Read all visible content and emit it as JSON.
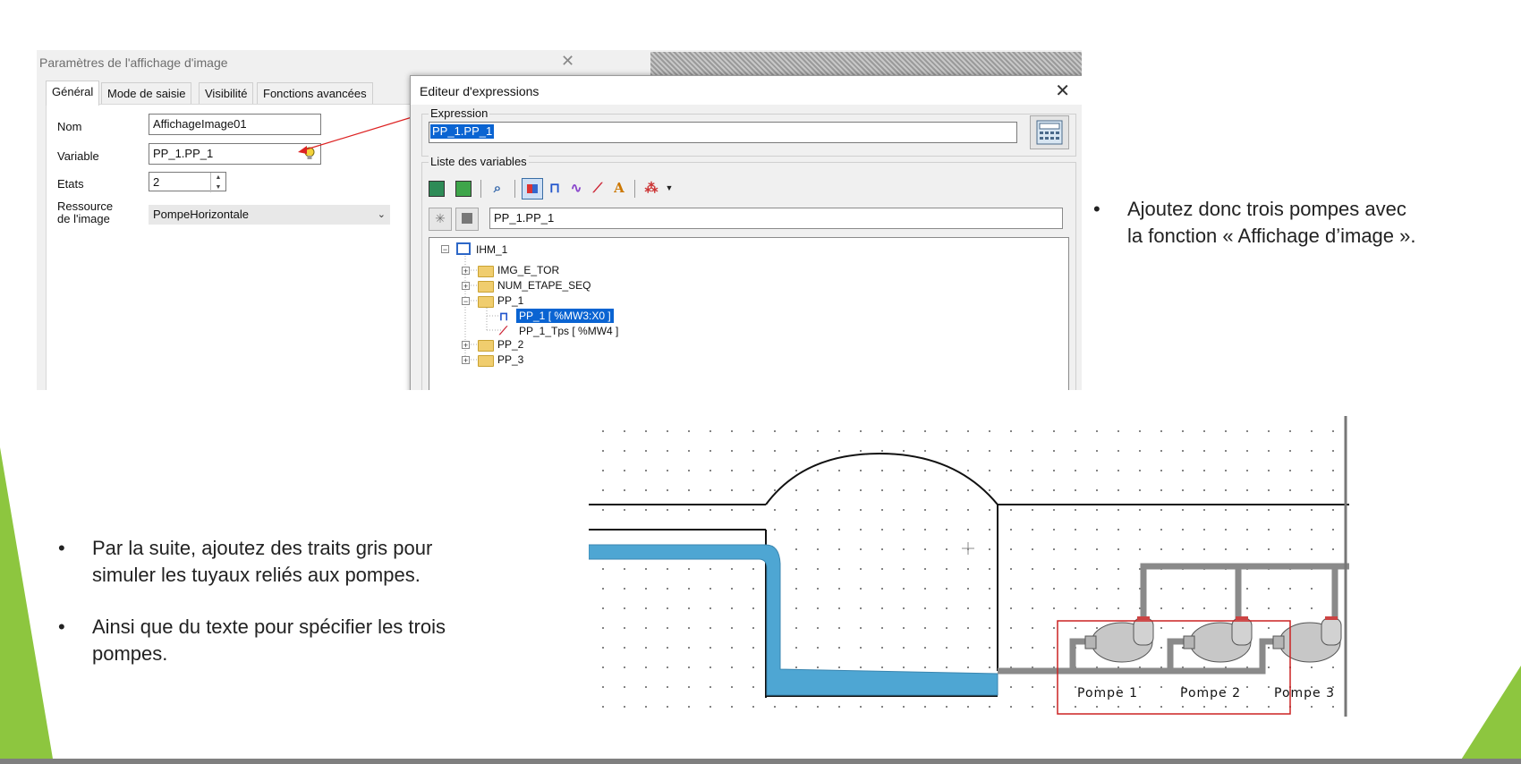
{
  "params_dialog": {
    "title": "Paramètres de l'affichage d'image",
    "close": "✕",
    "tabs": [
      "Général",
      "Mode de saisie",
      "Visibilité",
      "Fonctions avancées"
    ],
    "fields": {
      "nom_label": "Nom",
      "nom_value": "AffichageImage01",
      "variable_label": "Variable",
      "variable_value": "PP_1.PP_1",
      "etats_label": "Etats",
      "etats_value": "2",
      "ressource_label_1": "Ressource",
      "ressource_label_2": "de l'image",
      "ressource_value": "PompeHorizontale"
    }
  },
  "expr_editor": {
    "title": "Editeur d'expressions",
    "close": "✕",
    "expression_label": "Expression",
    "expression_value": "PP_1.PP_1",
    "variables_label": "Liste des variables",
    "filter_value": "PP_1.PP_1",
    "tree": {
      "root": "IHM_1",
      "items": [
        "IMG_E_TOR",
        "NUM_ETAPE_SEQ",
        "PP_1",
        "PP_2",
        "PP_3"
      ],
      "children": [
        "PP_1 [ %MW3:X0 ]",
        "PP_1_Tps [ %MW4 ]"
      ]
    }
  },
  "slide": {
    "bullet_right_1": "Ajoutez donc trois pompes avec",
    "bullet_right_2": "la fonction « Affichage d’image ».",
    "bullet_left_a1": "Par la suite, ajoutez des traits gris pour",
    "bullet_left_a2": "simuler les tuyaux reliés aux pompes.",
    "bullet_left_b1": "Ainsi que du texte pour spécifier les trois",
    "bullet_left_b2": "pompes.",
    "bullet_symbol": "•"
  },
  "schematic": {
    "pump_labels": [
      "Pompe 1",
      "Pompe 2",
      "Pompe 3"
    ]
  },
  "colors": {
    "accent_green": "#8dc63f",
    "water_blue": "#4ea6d3",
    "pipe_gray": "#8a8a8a",
    "highlight_red": "#cc2222",
    "selection_blue": "#0a64d2"
  }
}
